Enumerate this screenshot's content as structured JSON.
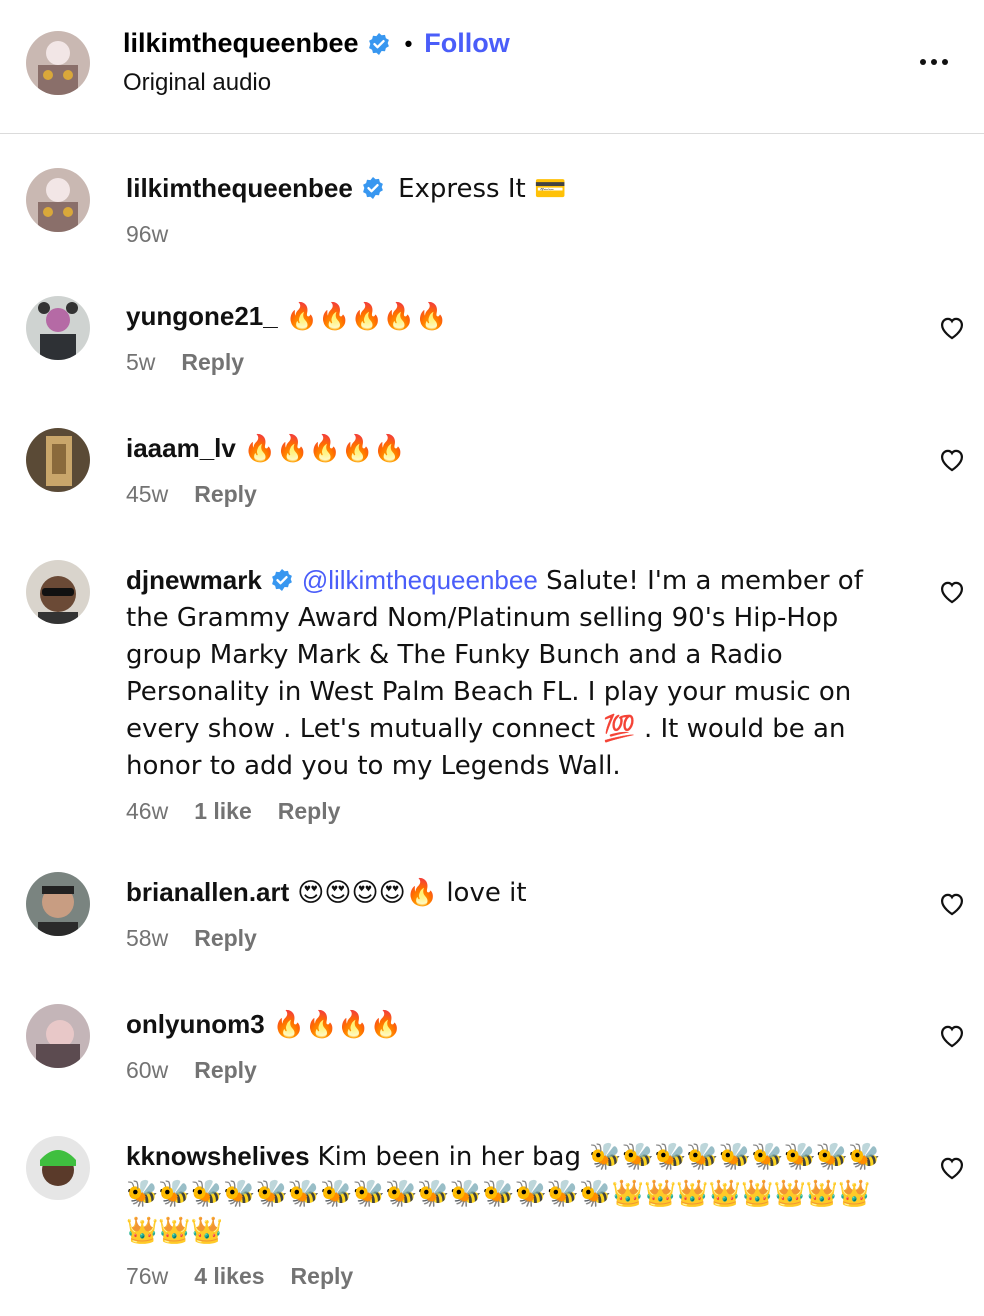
{
  "header": {
    "username": "lilkimthequeenbee",
    "separator": "•",
    "follow_label": "Follow",
    "subtitle": "Original audio"
  },
  "caption": {
    "username": "lilkimthequeenbee",
    "text": "Express It 💳",
    "age": "96w"
  },
  "comments": [
    {
      "username": "yungone21_",
      "text": "🔥🔥🔥🔥🔥",
      "age": "5w",
      "likes": "",
      "reply_label": "Reply"
    },
    {
      "username": "iaaam_lv",
      "text": "🔥🔥🔥🔥🔥",
      "age": "45w",
      "likes": "",
      "reply_label": "Reply"
    },
    {
      "username": "djnewmark",
      "mention": "@lilkimthequeenbee",
      "text": " Salute! I'm a member of the Grammy Award Nom/Platinum selling 90's Hip-Hop group Marky Mark & The Funky Bunch and a Radio Personality in West Palm Beach FL. I play your music on every show . Let's mutually connect 💯 . It would be an honor to add you to my Legends Wall.",
      "age": "46w",
      "likes": "1 like",
      "reply_label": "Reply"
    },
    {
      "username": "brianallen.art",
      "text": "😍😍😍😍🔥 love it",
      "age": "58w",
      "likes": "",
      "reply_label": "Reply"
    },
    {
      "username": "onlyunom3",
      "text": "🔥🔥🔥🔥",
      "age": "60w",
      "likes": "",
      "reply_label": "Reply"
    },
    {
      "username": "kknowshelives",
      "text": "Kim been in her bag 🐝🐝🐝🐝🐝🐝🐝🐝🐝🐝🐝🐝🐝🐝🐝🐝🐝🐝🐝🐝🐝🐝🐝🐝👑👑👑👑👑👑👑👑👑👑👑",
      "age": "76w",
      "likes": "4 likes",
      "reply_label": "Reply"
    }
  ],
  "icons": {
    "verified": "verified-badge-icon",
    "heart": "heart-outline-icon",
    "more": "more-horizontal-icon"
  },
  "colors": {
    "accent": "#4a5df9",
    "verified": "#3897f0",
    "muted": "#737373",
    "divider": "#dbdbdb"
  }
}
